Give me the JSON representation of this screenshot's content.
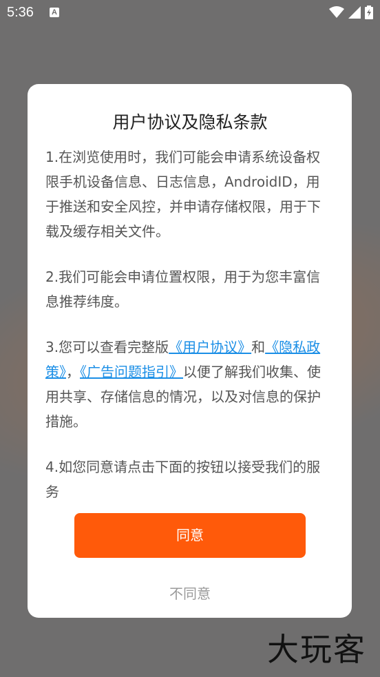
{
  "status_bar": {
    "time": "5:36",
    "notification_icon_letter": "A",
    "icons": [
      "wifi-icon",
      "signal-icon",
      "battery-icon"
    ]
  },
  "dialog": {
    "title": "用户协议及隐私条款",
    "paragraph1": "1.在浏览使用时，我们可能会申请系统设备权限手机设备信息、日志信息，AndroidID，用于推送和安全风控，并申请存储权限，用于下载及缓存相关文件。",
    "paragraph2": "2.我们可能会申请位置权限，用于为您丰富信息推荐纬度。",
    "paragraph3": {
      "prefix": "3.您可以查看完整版",
      "link_user_agreement": "《用户协议》",
      "and": "和",
      "link_privacy_policy": "《隐私政策》",
      "comma": "，",
      "link_ad_guide": "《广告问题指引》",
      "suffix": "以便了解我们收集、使用共享、存储信息的情况，以及对信息的保护措施。"
    },
    "paragraph4": "4.如您同意请点击下面的按钮以接受我们的服务",
    "agree_label": "同意",
    "disagree_label": "不同意"
  },
  "watermark": "大玩客",
  "colors": {
    "accent": "#ff5a0a",
    "link": "#1a8ee6",
    "overlay": "#6f6e6e"
  }
}
